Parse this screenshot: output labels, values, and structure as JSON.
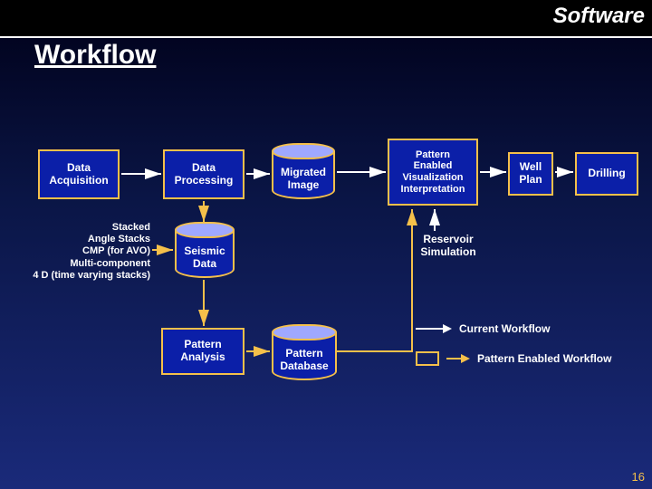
{
  "header": {
    "label": "Software"
  },
  "title": "Workflow",
  "slide_number": "16",
  "nodes": {
    "acq": {
      "label": "Data\nAcquisition"
    },
    "proc": {
      "label": "Data\nProcessing"
    },
    "migrated": {
      "label": "Migrated\nImage"
    },
    "pevi": {
      "label": "Pattern\nEnabled\nVisualization\nInterpretation"
    },
    "wellplan": {
      "label": "Well\nPlan"
    },
    "drilling": {
      "label": "Drilling"
    },
    "seismic": {
      "label": "Seismic\nData"
    },
    "patanal": {
      "label": "Pattern\nAnalysis"
    },
    "patdb": {
      "label": "Pattern\nDatabase"
    },
    "ressim": {
      "label": "Reservoir\nSimulation"
    }
  },
  "stacklist": [
    "Stacked",
    "Angle Stacks",
    "CMP (for AVO)",
    "Multi-component",
    "4 D (time varying stacks)"
  ],
  "legend": {
    "current": "Current Workflow",
    "pattern": "Pattern Enabled  Workflow"
  }
}
